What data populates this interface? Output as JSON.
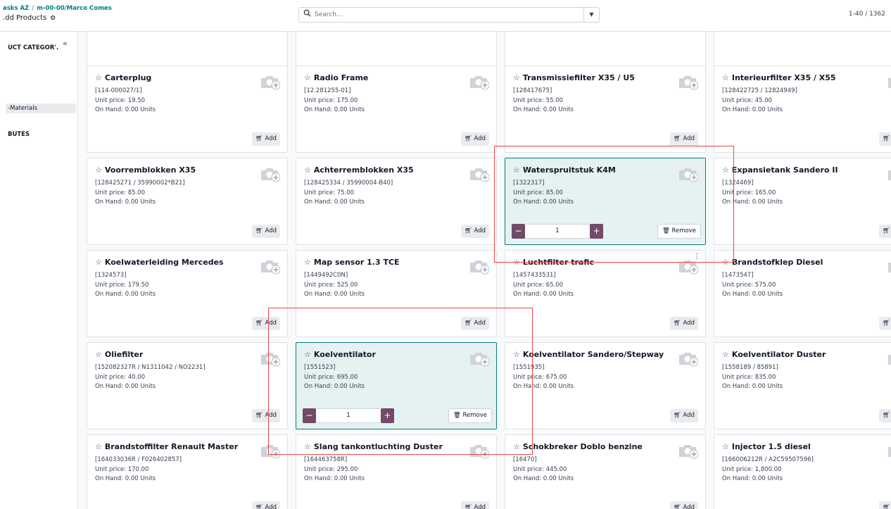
{
  "breadcrumb": {
    "parent": "asks AZ",
    "separator": "/",
    "current": "m-00-00/Marco Comes"
  },
  "page_title": ".dd Products",
  "search": {
    "placeholder": "Search..."
  },
  "pager": {
    "text": "1-40 / 1362"
  },
  "sidebar": {
    "collapse_glyph": "«",
    "categories_header": "UCT CATEGOR'.",
    "active_item": "-Materials",
    "attributes_header": "BUTES"
  },
  "labels": {
    "add": "Add",
    "remove": "Remove"
  },
  "icons": {
    "cart": "cart-icon",
    "camera": "camera-plus-icon",
    "trash": "trash-icon",
    "star": "star-outline-icon"
  },
  "top_partial_row": [
    {},
    {},
    {},
    {}
  ],
  "products": [
    {
      "name": "Carterplug",
      "ref": "[114-000027/1]",
      "price": "Unit price: 19.50",
      "onhand": "On Hand: 0.00 Units",
      "selected": false
    },
    {
      "name": "Radio Frame",
      "ref": "[12.281255-01]",
      "price": "Unit price: 175.00",
      "onhand": "On Hand: 0.00 Units",
      "selected": false
    },
    {
      "name": "Transmissiefilter X35 / U5",
      "ref": "[128417675]",
      "price": "Unit price: 55.00",
      "onhand": "On Hand: 0.00 Units",
      "selected": false
    },
    {
      "name": "Interieurfilter X35 / X55",
      "ref": "[128422725 / 12824949]",
      "price": "Unit price: 45.00",
      "onhand": "On Hand: 0.00 Units",
      "selected": false
    },
    {
      "name": "Voorremblokken X35",
      "ref": "[128425271 / 35990002*B21]",
      "price": "Unit price: 85.00",
      "onhand": "On Hand: 0.00 Units",
      "selected": false
    },
    {
      "name": "Achterremblokken X35",
      "ref": "[128425334 / 35990004-B40]",
      "price": "Unit price: 75.00",
      "onhand": "On Hand: 0.00 Units",
      "selected": false
    },
    {
      "name": "Waterspruitstuk K4M",
      "ref": "[1322317]",
      "price": "Unit price: 85.00",
      "onhand": "On Hand: 0.00 Units",
      "selected": true,
      "qty": "1"
    },
    {
      "name": "Expansietank Sandero II",
      "ref": "[1324469]",
      "price": "Unit price: 165.00",
      "onhand": "On Hand: 0.00 Units",
      "selected": false
    },
    {
      "name": "Koelwaterleiding Mercedes",
      "ref": "[1324573]",
      "price": "Unit price: 179.50",
      "onhand": "On Hand: 0.00 Units",
      "selected": false
    },
    {
      "name": "Map sensor 1.3 TCE",
      "ref": "[1449492C0N]",
      "price": "Unit price: 525.00",
      "onhand": "On Hand: 0.00 Units",
      "selected": false
    },
    {
      "name": "Luchtfilter trafic",
      "ref": "[1457433531]",
      "price": "Unit price: 65.00",
      "onhand": "On Hand: 0.00 Units",
      "selected": false,
      "kebab": "⋮"
    },
    {
      "name": "Brandstofklep Diesel",
      "ref": "[1473547]",
      "price": "Unit price: 575.00",
      "onhand": "On Hand: 0.00 Units",
      "selected": false
    },
    {
      "name": "Oliefilter",
      "ref": "[152082327R / N1311042 / NO2231]",
      "price": "Unit price: 40.00",
      "onhand": "On Hand: 0.00 Units",
      "selected": false
    },
    {
      "name": "Koelventilator",
      "ref": "[1551523]",
      "price": "Unit price: 695.00",
      "onhand": "On Hand: 0.00 Units",
      "selected": true,
      "qty": "1"
    },
    {
      "name": "Koelventilator Sandero/Stepway",
      "ref": "[1551935]",
      "price": "Unit price: 675.00",
      "onhand": "On Hand: 0.00 Units",
      "selected": false
    },
    {
      "name": "Koelventilator Duster",
      "ref": "[1558189 / 85891]",
      "price": "Unit price: 835.00",
      "onhand": "On Hand: 0.00 Units",
      "selected": false
    },
    {
      "name": "Brandstoffilter Renault Master",
      "ref": "[164033036R / F026402857]",
      "price": "Unit price: 170.00",
      "onhand": "On Hand: 0.00 Units",
      "selected": false
    },
    {
      "name": "Slang tankontluchting Duster",
      "ref": "[164463758R]",
      "price": "Unit price: 295.00",
      "onhand": "On Hand: 0.00 Units",
      "selected": false
    },
    {
      "name": "Schokbreker Doblo benzine",
      "ref": "[16470]",
      "price": "Unit price: 445.00",
      "onhand": "On Hand: 0.00 Units",
      "selected": false
    },
    {
      "name": "Injector 1.5 diesel",
      "ref": "[166006212R / A2C59507596]",
      "price": "Unit price: 1,800.00",
      "onhand": "On Hand: 0.00 Units",
      "selected": false
    }
  ]
}
